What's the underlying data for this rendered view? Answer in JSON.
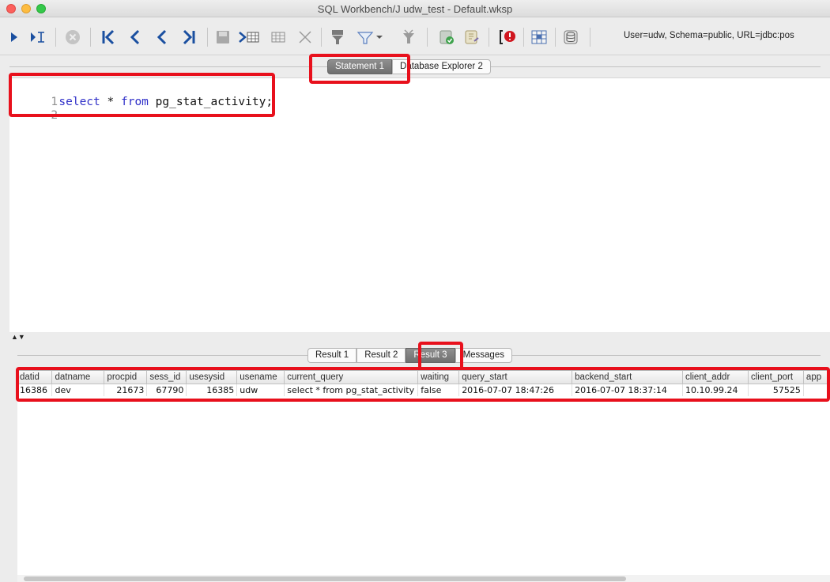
{
  "window": {
    "title": "SQL Workbench/J udw_test - Default.wksp"
  },
  "toolbar": {
    "connection_info": "User=udw, Schema=public, URL=jdbc:pos",
    "icons": [
      "execute-icon",
      "execute-current-icon",
      "stop-icon",
      "first-record-icon",
      "previous-icon",
      "previous-record-icon",
      "last-record-icon",
      "save-icon",
      "insert-row-icon",
      "copy-row-icon",
      "delete-row-icon",
      "filter-icon",
      "filter-dropdown-icon",
      "clear-filter-icon",
      "commit-icon",
      "rollback-icon",
      "error-icon",
      "table-icon",
      "database-icon"
    ]
  },
  "editor_tabs": [
    {
      "label": "Statement 1",
      "active": true
    },
    {
      "label": "Database Explorer 2",
      "active": false
    }
  ],
  "editor": {
    "lines": [
      {
        "num": "1",
        "keyword1": "select",
        "star": "*",
        "keyword2": "from",
        "rest": "pg_stat_activity;"
      },
      {
        "num": "2"
      }
    ]
  },
  "result_tabs": [
    {
      "label": "Result 1",
      "active": false
    },
    {
      "label": "Result 2",
      "active": false
    },
    {
      "label": "Result 3",
      "active": true
    },
    {
      "label": "Messages",
      "active": false
    }
  ],
  "results": {
    "columns": [
      "datid",
      "datname",
      "procpid",
      "sess_id",
      "usesysid",
      "usename",
      "current_query",
      "waiting",
      "query_start",
      "backend_start",
      "client_addr",
      "client_port",
      "app"
    ],
    "rows": [
      [
        "16386",
        "dev",
        "21673",
        "67790",
        "16385",
        "udw",
        "select * from pg_stat_activity",
        "false",
        "2016-07-07 18:47:26",
        "2016-07-07 18:37:14",
        "10.10.99.24",
        "57525",
        ""
      ]
    ]
  },
  "colors": {
    "highlight": "#e8101c",
    "keyword": "#2f2fc8",
    "active_tab": "#7a7a7a"
  }
}
